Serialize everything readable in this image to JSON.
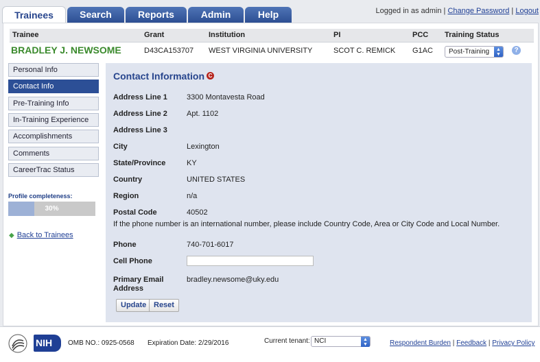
{
  "tabs": [
    {
      "label": "Trainees",
      "active": true
    },
    {
      "label": "Search"
    },
    {
      "label": "Reports"
    },
    {
      "label": "Admin"
    },
    {
      "label": "Help"
    }
  ],
  "login": {
    "text": "Logged in as admin",
    "change_password": "Change Password",
    "logout": "Logout",
    "separator": "|"
  },
  "trainee": {
    "headers": {
      "trainee": "Trainee",
      "grant": "Grant",
      "institution": "Institution",
      "pi": "PI",
      "pcc": "PCC",
      "status": "Training Status"
    },
    "name": "BRADLEY J. NEWSOME",
    "grant": "D43CA153707",
    "institution": "WEST VIRGINIA UNIVERSITY",
    "pi": "SCOT C. REMICK",
    "pcc": "G1AC",
    "status": "Post-Training",
    "help_icon": "?"
  },
  "sidebar": {
    "items": [
      {
        "label": "Personal Info"
      },
      {
        "label": "Contact Info",
        "active": true
      },
      {
        "label": "Pre-Training Info"
      },
      {
        "label": "In-Training Experience"
      },
      {
        "label": "Accomplishments"
      },
      {
        "label": "Comments"
      },
      {
        "label": "CareerTrac Status"
      }
    ],
    "completeness_label": "Profile completeness:",
    "completeness_text": "30%",
    "completeness_value": 0.3,
    "back_link": "Back to Trainees"
  },
  "contact": {
    "title": "Contact Information",
    "title_icon": "C",
    "fields": {
      "address1": {
        "label": "Address Line 1",
        "value": "3300 Montavesta Road"
      },
      "address2": {
        "label": "Address Line 2",
        "value": "Apt. 1102"
      },
      "address3": {
        "label": "Address Line 3",
        "value": ""
      },
      "city": {
        "label": "City",
        "value": "Lexington"
      },
      "state": {
        "label": "State/Province",
        "value": "KY"
      },
      "country": {
        "label": "Country",
        "value": "UNITED STATES"
      },
      "region": {
        "label": "Region",
        "value": "n/a"
      },
      "postal": {
        "label": "Postal Code",
        "value": "40502"
      },
      "phone": {
        "label": "Phone",
        "value": "740-701-6017"
      },
      "cell": {
        "label": "Cell Phone",
        "value": ""
      },
      "email_label1": "Primary Email",
      "email_label2": "Address",
      "email": "bradley.newsome@uky.edu"
    },
    "phone_note": "If the phone number is an international number, please include Country Code, Area or City Code and Local Number.",
    "update_button": "Update",
    "reset_button": "Reset"
  },
  "footer": {
    "nih_logo": "NIH",
    "omb": "OMB NO.: 0925-0568",
    "expiration": "Expiration Date: 2/29/2016",
    "tenant_label": "Current tenant:",
    "tenant_value": "NCI",
    "links": [
      "Respondent Burden",
      "Feedback",
      "Privacy Policy"
    ],
    "separator": "|"
  },
  "colors": {
    "accent": "#2c4f96",
    "trainee_name": "#3a8a2c",
    "title": "#27458d"
  }
}
